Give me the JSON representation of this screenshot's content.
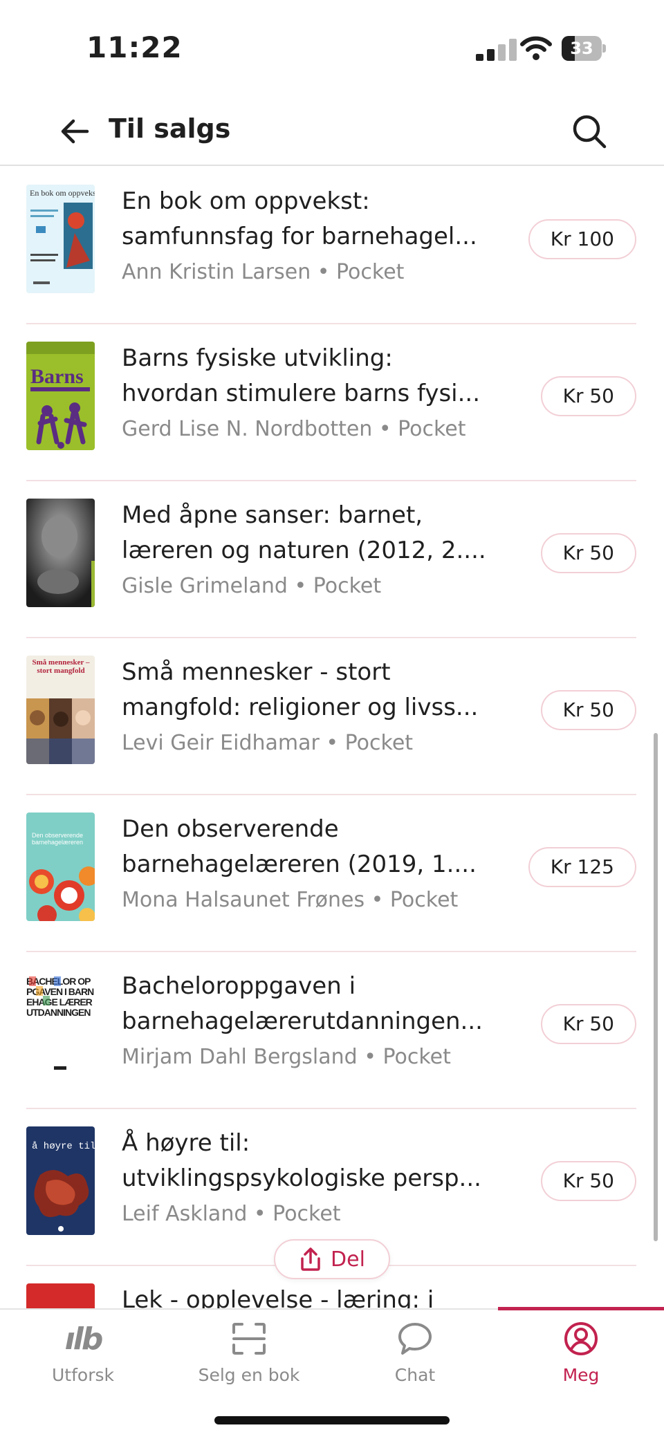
{
  "status_bar": {
    "time": "11:22",
    "battery": "33",
    "battery_level": 0.33
  },
  "header": {
    "title": "Til salgs"
  },
  "colors": {
    "accent": "#c2224f",
    "badge_border": "#f2cfd6",
    "divider": "#f3dfe3",
    "meta_text": "#8a8a8a"
  },
  "listings": [
    {
      "title_line1": "En bok om oppvekst:",
      "title_line2": "samfunnsfag for barnehagel...",
      "author": "Ann Kristin Larsen",
      "format": "Pocket",
      "price": "Kr 100",
      "cover_text": "En bok om oppvekst"
    },
    {
      "title_line1": "Barns fysiske utvikling:",
      "title_line2": "hvordan stimulere barns fysi...",
      "author": "Gerd Lise N. Nordbotten",
      "format": "Pocket",
      "price": "Kr 50",
      "cover_text": "Barns"
    },
    {
      "title_line1": "Med åpne sanser: barnet,",
      "title_line2": "læreren og naturen (2012, 2....",
      "author": "Gisle Grimeland",
      "format": "Pocket",
      "price": "Kr 50",
      "cover_text": ""
    },
    {
      "title_line1": "Små mennesker - stort",
      "title_line2": "mangfold: religioner og livss...",
      "author": "Levi Geir Eidhamar",
      "format": "Pocket",
      "price": "Kr 50",
      "cover_text": "Små mennesker – stort mangfold"
    },
    {
      "title_line1": "Den observerende",
      "title_line2": "barnehagelæreren (2019, 1....",
      "author": "Mona Halsaunet Frønes",
      "format": "Pocket",
      "price": "Kr 125",
      "cover_text": "Den observerende barnehagelæreren"
    },
    {
      "title_line1": "Bacheloroppgaven i",
      "title_line2": "barnehagelærerutdanningen...",
      "author": "Mirjam Dahl Bergsland",
      "format": "Pocket",
      "price": "Kr 50",
      "cover_text": "BACHELOR OPPGAVEN I BARNEHAGE LÆRER UTDANNINGEN"
    },
    {
      "title_line1": "Å høyre til:",
      "title_line2": "utviklingspsykologiske persp...",
      "author": "Leif Askland",
      "format": "Pocket",
      "price": "Kr 50",
      "cover_text": "å høyre til"
    },
    {
      "title_line1": "Lek - opplevelse - læring: i",
      "title_line2": "",
      "author": "",
      "format": "",
      "price": "",
      "cover_text": ""
    }
  ],
  "meta_separator": " • ",
  "share_button": {
    "label": "Del"
  },
  "bottom_nav": {
    "items": [
      {
        "label": "Utforsk",
        "icon": "bookis-logo-icon",
        "glyph": "ılb"
      },
      {
        "label": "Selg en bok",
        "icon": "scan-icon"
      },
      {
        "label": "Chat",
        "icon": "chat-bubble-icon"
      },
      {
        "label": "Meg",
        "icon": "profile-icon"
      }
    ],
    "active": "Meg"
  }
}
